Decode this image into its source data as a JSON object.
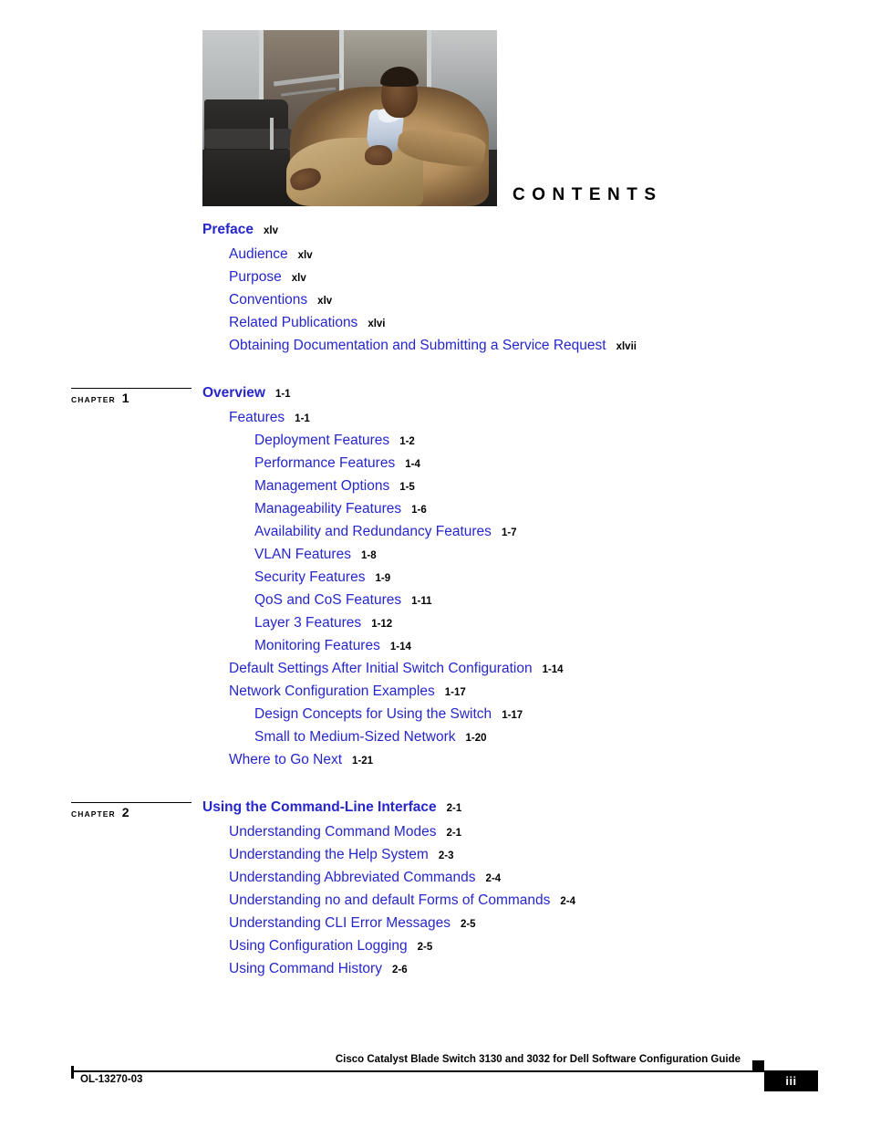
{
  "page": {
    "heading": "CONTENTS",
    "hero_image_alt": "seated-man-in-lobby-photo"
  },
  "toc": {
    "blocks": [
      {
        "chapter_marker": null,
        "entries": [
          {
            "level": 1,
            "title": "Preface",
            "page": "xlv"
          },
          {
            "level": 2,
            "title": "Audience",
            "page": "xlv"
          },
          {
            "level": 2,
            "title": "Purpose",
            "page": "xlv"
          },
          {
            "level": 2,
            "title": "Conventions",
            "page": "xlv"
          },
          {
            "level": 2,
            "title": "Related Publications",
            "page": "xlvi"
          },
          {
            "level": 2,
            "title": "Obtaining Documentation and Submitting a Service Request",
            "page": "xlvii"
          }
        ]
      },
      {
        "chapter_marker": {
          "word": "CHAPTER",
          "number": "1"
        },
        "entries": [
          {
            "level": 1,
            "title": "Overview",
            "page": "1-1"
          },
          {
            "level": 2,
            "title": "Features",
            "page": "1-1"
          },
          {
            "level": 3,
            "title": "Deployment Features",
            "page": "1-2"
          },
          {
            "level": 3,
            "title": "Performance Features",
            "page": "1-4"
          },
          {
            "level": 3,
            "title": "Management Options",
            "page": "1-5"
          },
          {
            "level": 3,
            "title": "Manageability Features",
            "page": "1-6"
          },
          {
            "level": 3,
            "title": "Availability and Redundancy Features",
            "page": "1-7"
          },
          {
            "level": 3,
            "title": "VLAN Features",
            "page": "1-8"
          },
          {
            "level": 3,
            "title": "Security Features",
            "page": "1-9"
          },
          {
            "level": 3,
            "title": "QoS and CoS Features",
            "page": "1-11"
          },
          {
            "level": 3,
            "title": "Layer 3 Features",
            "page": "1-12"
          },
          {
            "level": 3,
            "title": "Monitoring Features",
            "page": "1-14"
          },
          {
            "level": 2,
            "title": "Default Settings After Initial Switch Configuration",
            "page": "1-14"
          },
          {
            "level": 2,
            "title": "Network Configuration Examples",
            "page": "1-17"
          },
          {
            "level": 3,
            "title": "Design Concepts for Using the Switch",
            "page": "1-17"
          },
          {
            "level": 3,
            "title": "Small to Medium-Sized Network",
            "page": "1-20"
          },
          {
            "level": 2,
            "title": "Where to Go Next",
            "page": "1-21"
          }
        ]
      },
      {
        "chapter_marker": {
          "word": "CHAPTER",
          "number": "2"
        },
        "entries": [
          {
            "level": 1,
            "title": "Using the Command-Line Interface",
            "page": "2-1"
          },
          {
            "level": 2,
            "title": "Understanding Command Modes",
            "page": "2-1"
          },
          {
            "level": 2,
            "title": "Understanding the Help System",
            "page": "2-3"
          },
          {
            "level": 2,
            "title": "Understanding Abbreviated Commands",
            "page": "2-4"
          },
          {
            "level": 2,
            "title": "Understanding no and default Forms of Commands",
            "page": "2-4"
          },
          {
            "level": 2,
            "title": "Understanding CLI Error Messages",
            "page": "2-5"
          },
          {
            "level": 2,
            "title": "Using Configuration Logging",
            "page": "2-5"
          },
          {
            "level": 2,
            "title": "Using Command History",
            "page": "2-6"
          }
        ]
      }
    ]
  },
  "footer": {
    "title": "Cisco Catalyst Blade Switch 3130 and 3032 for Dell Software Configuration Guide",
    "doc_id": "OL-13270-03",
    "page_number": "iii"
  },
  "colors": {
    "link_blue": "#2626CC",
    "text_black": "#000000",
    "page_white": "#ffffff"
  }
}
